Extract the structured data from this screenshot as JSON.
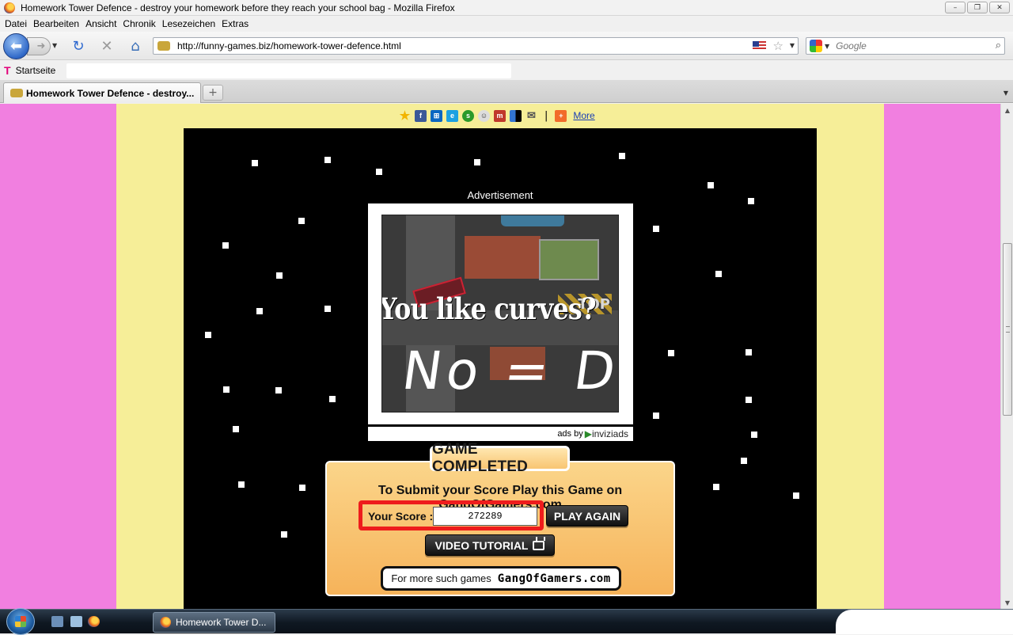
{
  "window": {
    "title": "Homework Tower Defence - destroy your homework before they reach your school bag - Mozilla Firefox",
    "controls": [
      "–",
      "❐",
      "✕"
    ]
  },
  "menu": [
    "Datei",
    "Bearbeiten",
    "Ansicht",
    "Chronik",
    "Lesezeichen",
    "Extras"
  ],
  "nav": {
    "url": "http://funny-games.biz/homework-tower-defence.html",
    "search_placeholder": "Google"
  },
  "bookmarks": {
    "items": [
      "Startseite"
    ]
  },
  "tabs": [
    {
      "label": "Homework Tower Defence - destroy...",
      "active": true
    }
  ],
  "share": {
    "icons": [
      "favorite-star",
      "facebook",
      "windows-live",
      "bebo",
      "stumbleupon",
      "reddit",
      "myspace",
      "delicious",
      "email"
    ],
    "more_label": "More"
  },
  "game": {
    "ad_label": "Advertisement",
    "ad_headline": "You like curves?",
    "ad_scrawl": "No = D",
    "ad_stop_text": "TOP",
    "ads_by_prefix": "ads by",
    "ads_by_brand": "inviziads",
    "completed_title": "GAME COMPLETED",
    "submit_text": "To Submit your Score Play this Game on GangOfGamers.com",
    "score_label": "Your Score :",
    "score_value": "272289",
    "play_again_label": "PLAY AGAIN",
    "video_tutorial_label": "VIDEO TUTORIAL",
    "more_games_text": "For more such games",
    "more_games_logo": "GangOfGamers.com"
  },
  "taskbar": {
    "items": [
      "Homework Tower D..."
    ]
  },
  "colors": {
    "page_bg": "#f17fe0",
    "panel_bg": "#f6ee98",
    "game_bg": "#000000",
    "card_orange": "#f6b35a",
    "score_highlight": "#ee1c1c"
  }
}
